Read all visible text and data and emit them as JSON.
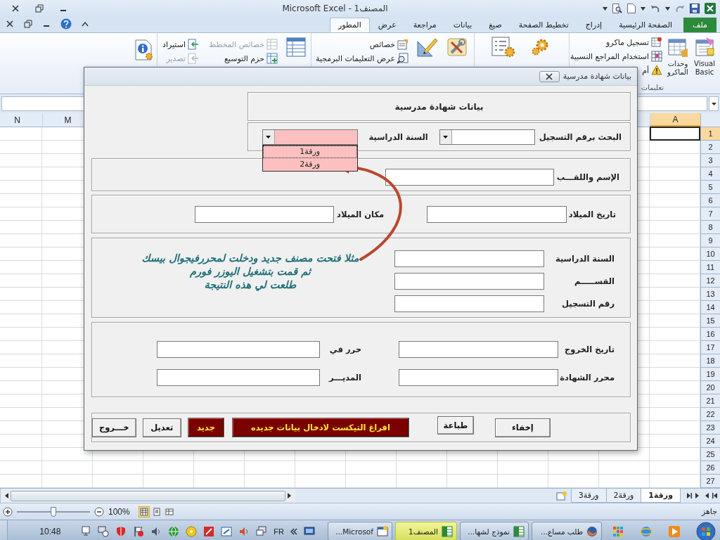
{
  "window": {
    "title": "المصنف1 - Microsoft Excel"
  },
  "ribbon_tabs": [
    {
      "label": "ملف",
      "kind": "file",
      "selected": false
    },
    {
      "label": "الصفحة الرئيسية",
      "kind": "tab",
      "selected": false
    },
    {
      "label": "إدراج",
      "kind": "tab",
      "selected": false
    },
    {
      "label": "تخطيط الصفحة",
      "kind": "tab",
      "selected": false
    },
    {
      "label": "صيغ",
      "kind": "tab",
      "selected": false
    },
    {
      "label": "بيانات",
      "kind": "tab",
      "selected": false
    },
    {
      "label": "مراجعة",
      "kind": "tab",
      "selected": false
    },
    {
      "label": "عرض",
      "kind": "tab",
      "selected": false
    },
    {
      "label": "المطور",
      "kind": "tab",
      "selected": true
    }
  ],
  "ribbon": {
    "code_group": {
      "large_buttons": [
        "Visual Basic",
        "وحدات الماكرو"
      ],
      "small_buttons": [
        {
          "label": "تسجيل ماكرو",
          "disabled": false
        },
        {
          "label": "استخدام المراجع النسبية",
          "disabled": false
        },
        {
          "label": "أم",
          "disabled": false
        }
      ],
      "group_label": "تعليمات"
    },
    "controls_group": {
      "small_buttons": [
        {
          "label": "خصائص",
          "disabled": false
        },
        {
          "label": "عرض التعليمات البرمجية",
          "disabled": false
        }
      ]
    },
    "xml_group": {
      "small_buttons": [
        {
          "label": "خصائص المخطط",
          "disabled": true
        },
        {
          "label": "استيراد",
          "disabled": false
        },
        {
          "label": "حزم التوسيع",
          "disabled": false
        },
        {
          "label": "تصدير",
          "disabled": true
        }
      ]
    }
  },
  "sheet": {
    "column_headers": [
      {
        "label": "A",
        "selected": true
      },
      {
        "label": "M",
        "selected": false
      },
      {
        "label": "N",
        "selected": false
      }
    ],
    "row_numbers": [
      {
        "label": "1",
        "selected": true
      },
      {
        "label": "2",
        "selected": false
      },
      {
        "label": "3",
        "selected": false
      },
      {
        "label": "4",
        "selected": false
      },
      {
        "label": "5",
        "selected": false
      },
      {
        "label": "6",
        "selected": false
      },
      {
        "label": "7",
        "selected": false
      },
      {
        "label": "8",
        "selected": false
      },
      {
        "label": "9",
        "selected": false
      },
      {
        "label": "10",
        "selected": false
      },
      {
        "label": "11",
        "selected": false
      },
      {
        "label": "12",
        "selected": false
      },
      {
        "label": "13",
        "selected": false
      },
      {
        "label": "14",
        "selected": false
      },
      {
        "label": "15",
        "selected": false
      },
      {
        "label": "16",
        "selected": false
      },
      {
        "label": "17",
        "selected": false
      },
      {
        "label": "18",
        "selected": false
      },
      {
        "label": "19",
        "selected": false
      },
      {
        "label": "20",
        "selected": false
      },
      {
        "label": "21",
        "selected": false
      },
      {
        "label": "22",
        "selected": false
      },
      {
        "label": "23",
        "selected": false
      },
      {
        "label": "24",
        "selected": false
      },
      {
        "label": "25",
        "selected": false
      },
      {
        "label": "26",
        "selected": false
      },
      {
        "label": "27",
        "selected": false
      }
    ]
  },
  "sheet_tabs": [
    {
      "label": "ورقة1",
      "selected": true
    },
    {
      "label": "ورقة2",
      "selected": false
    },
    {
      "label": "ورقة3",
      "selected": false
    }
  ],
  "status_bar": {
    "status": "جاهز",
    "zoom": "100%",
    "zoom_slider": {
      "level": 0.5
    },
    "views": [
      {
        "selected": false
      },
      {
        "selected": false
      },
      {
        "selected": true
      }
    ]
  },
  "taskbar": {
    "tasks": [
      {
        "label": "طلب مساع...",
        "kind": "browser",
        "selected": false
      },
      {
        "label": "نموذج لشها...",
        "kind": "spreadsheet",
        "selected": false
      },
      {
        "label": "المصنف1",
        "kind": "spreadsheet",
        "selected": true
      },
      {
        "label": "Microsof...",
        "kind": "window",
        "selected": false
      }
    ],
    "language": "FR",
    "clock": "10:48"
  },
  "dialog": {
    "title": "بيانات شهادة مدرسية",
    "heading": "بيانات شهادة مدرسية",
    "search": {
      "label": "البحث برقم التسجيل"
    },
    "year_select": {
      "label": "السنة الدراسية",
      "expanded": true,
      "options": [
        {
          "label": "ورقة1",
          "selected": true
        },
        {
          "label": "ورقة2",
          "selected": false
        }
      ]
    },
    "name_section": {
      "fields": [
        "الإسم واللقـــب"
      ]
    },
    "birth_section": {
      "fields": [
        "تاريخ الميلاد",
        "مكان الميلاد"
      ]
    },
    "study_section": {
      "fields": [
        "السنة الدراسية",
        "القســـــم",
        "رقم التسجيل"
      ]
    },
    "note": "مثلا فتحت مصنف جديد ودخلت لمحررفيجوال بيسك\nثم قمت بتشغيل اليوزر فورم\nطلعت لي هذه النتيجة",
    "exit_section": {
      "fields": [
        "تاريخ الخروج",
        "حرر في",
        "محرر الشهادة",
        "المديـــر"
      ]
    },
    "buttons": [
      {
        "label": "إخفاء",
        "kind": "normal"
      },
      {
        "label": "طباعة",
        "kind": "normal"
      },
      {
        "label": "افراغ التيكست لادخال بيانات جديده",
        "kind": "accent"
      },
      {
        "label": "جديد",
        "kind": "accent"
      },
      {
        "label": "تعديل",
        "kind": "normal"
      },
      {
        "label": "خـــروج",
        "kind": "normal"
      }
    ]
  }
}
